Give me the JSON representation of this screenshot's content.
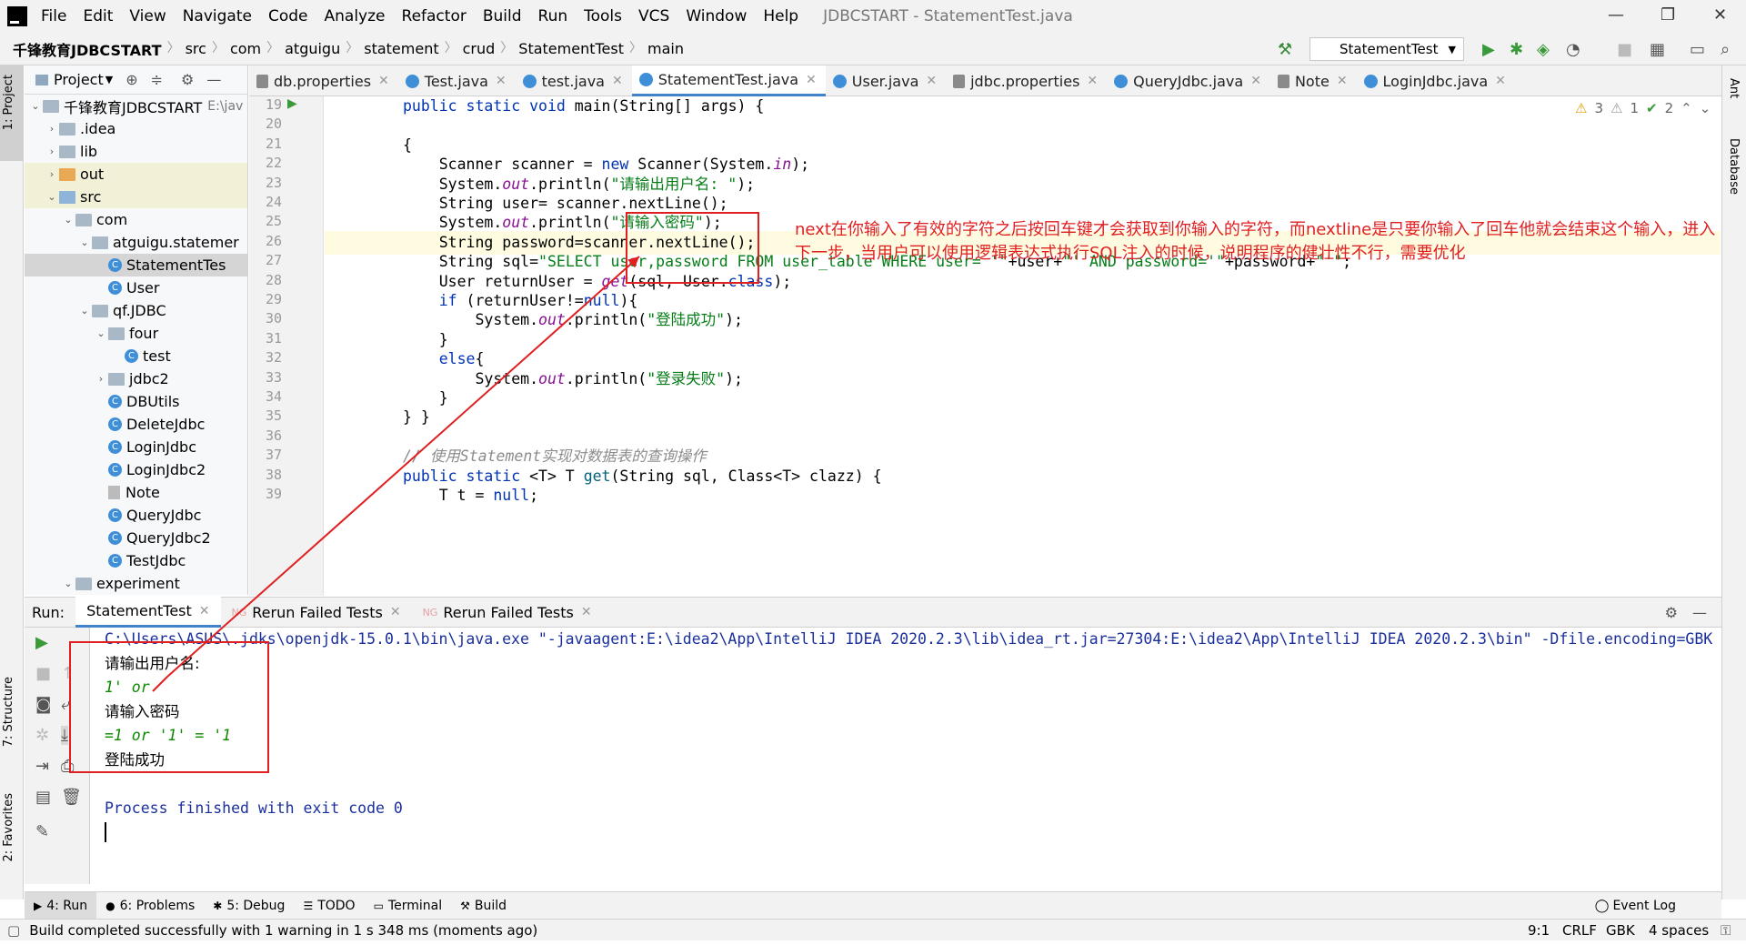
{
  "menu": [
    "File",
    "Edit",
    "View",
    "Navigate",
    "Code",
    "Analyze",
    "Refactor",
    "Build",
    "Run",
    "Tools",
    "VCS",
    "Window",
    "Help"
  ],
  "window_title": "JDBCSTART - StatementTest.java",
  "breadcrumbs": [
    "千锋教育JDBCSTART",
    "src",
    "com",
    "atguigu",
    "statement",
    "crud",
    "StatementTest",
    "main"
  ],
  "run_config": "StatementTest",
  "left_stripe": {
    "project": "1: Project",
    "structure": "7: Structure",
    "favorites": "2: Favorites"
  },
  "right_stripe": {
    "ant": "Ant",
    "database": "Database"
  },
  "project_panel": {
    "title": "Project",
    "tree": [
      {
        "label": "千锋教育JDBCSTART",
        "suffix": "E:\\jav",
        "indent": 0,
        "arrow": "down",
        "icon": "folder"
      },
      {
        "label": ".idea",
        "indent": 1,
        "arrow": "right",
        "icon": "folder"
      },
      {
        "label": "lib",
        "indent": 1,
        "arrow": "right",
        "icon": "folder"
      },
      {
        "label": "out",
        "indent": 1,
        "arrow": "right",
        "icon": "folder-orange"
      },
      {
        "label": "src",
        "indent": 1,
        "arrow": "down",
        "icon": "folder-blue"
      },
      {
        "label": "com",
        "indent": 2,
        "arrow": "down",
        "icon": "folder"
      },
      {
        "label": "atguigu.statemer",
        "indent": 3,
        "arrow": "down",
        "icon": "folder"
      },
      {
        "label": "StatementTes",
        "indent": 4,
        "arrow": "",
        "icon": "class"
      },
      {
        "label": "User",
        "indent": 4,
        "arrow": "",
        "icon": "class"
      },
      {
        "label": "qf.JDBC",
        "indent": 3,
        "arrow": "down",
        "icon": "folder"
      },
      {
        "label": "four",
        "indent": 4,
        "arrow": "down",
        "icon": "folder"
      },
      {
        "label": "test",
        "indent": 5,
        "arrow": "",
        "icon": "class"
      },
      {
        "label": "jdbc2",
        "indent": 4,
        "arrow": "right",
        "icon": "folder"
      },
      {
        "label": "DBUtils",
        "indent": 4,
        "arrow": "",
        "icon": "class"
      },
      {
        "label": "DeleteJdbc",
        "indent": 4,
        "arrow": "",
        "icon": "class"
      },
      {
        "label": "LoginJdbc",
        "indent": 4,
        "arrow": "",
        "icon": "class"
      },
      {
        "label": "LoginJdbc2",
        "indent": 4,
        "arrow": "",
        "icon": "class"
      },
      {
        "label": "Note",
        "indent": 4,
        "arrow": "",
        "icon": "note"
      },
      {
        "label": "QueryJdbc",
        "indent": 4,
        "arrow": "",
        "icon": "class"
      },
      {
        "label": "QueryJdbc2",
        "indent": 4,
        "arrow": "",
        "icon": "class"
      },
      {
        "label": "TestJdbc",
        "indent": 4,
        "arrow": "",
        "icon": "class"
      },
      {
        "label": "experiment",
        "indent": 2,
        "arrow": "down",
        "icon": "folder"
      }
    ]
  },
  "editor_tabs": [
    {
      "label": "db.properties",
      "icon": "prop"
    },
    {
      "label": "Test.java",
      "icon": "class"
    },
    {
      "label": "test.java",
      "icon": "class"
    },
    {
      "label": "StatementTest.java",
      "icon": "class",
      "active": true
    },
    {
      "label": "User.java",
      "icon": "class"
    },
    {
      "label": "jdbc.properties",
      "icon": "prop"
    },
    {
      "label": "QueryJdbc.java",
      "icon": "class"
    },
    {
      "label": "Note",
      "icon": "prop"
    },
    {
      "label": "LoginJdbc.java",
      "icon": "class"
    }
  ],
  "inspections": {
    "warnings": "3",
    "weak": "1",
    "ok": "2"
  },
  "code_lines": [
    {
      "n": "19",
      "html": "<span class='kw'>public static void</span> main(String[] args) {"
    },
    {
      "n": "20",
      "html": ""
    },
    {
      "n": "21",
      "html": "{"
    },
    {
      "n": "22",
      "html": "    Scanner scanner = <span class='kw'>new</span> Scanner(System.<span class='it'>in</span>);"
    },
    {
      "n": "23",
      "html": "    System.<span class='it'>out</span>.println(<span class='st'>\"请输出用户名: \"</span>);"
    },
    {
      "n": "24",
      "html": "    String user= scanner.nextLine();"
    },
    {
      "n": "25",
      "html": "    System.<span class='it'>out</span>.println(<span class='st'>\"请输入密码\"</span>);"
    },
    {
      "n": "26",
      "html": "    String password=scanner.nextLine();",
      "cur": true
    },
    {
      "n": "27",
      "html": "    String sql=<span class='st'>\"SELECT user,password FROM user_table WHERE user= '\"</span>+user+<span class='st'>\"' AND password='\"</span>+password+<span class='st'>\"'\"</span>;"
    },
    {
      "n": "28",
      "html": "    User returnUser = <span class='it'>get</span>(sql, User.<span class='kw'>class</span>);"
    },
    {
      "n": "29",
      "html": "    <span class='kw'>if</span> (returnUser!=<span class='kw'>null</span>){"
    },
    {
      "n": "30",
      "html": "        System.<span class='it'>out</span>.println(<span class='st'>\"登陆成功\"</span>);"
    },
    {
      "n": "31",
      "html": "    }"
    },
    {
      "n": "32",
      "html": "    <span class='kw'>else</span>{"
    },
    {
      "n": "33",
      "html": "        System.<span class='it'>out</span>.println(<span class='st'>\"登录失败\"</span>);"
    },
    {
      "n": "34",
      "html": "    }"
    },
    {
      "n": "35",
      "html": "} }"
    },
    {
      "n": "36",
      "html": ""
    },
    {
      "n": "37",
      "html": "<span class='cm'>// 使用Statement实现对数据表的查询操作</span>"
    },
    {
      "n": "38",
      "html": "<span class='kw'>public static</span> &lt;T&gt; T <span style='color:#00627a'>get</span>(String sql, Class&lt;T&gt; clazz) {"
    },
    {
      "n": "39",
      "html": "    T t = <span class='kw'>null</span>;"
    }
  ],
  "annotation": "next在你输入了有效的字符之后按回车键才会获取到你输入的字符，而nextline是只要你输入了回车他就会结束这个输入，进入下一步，当用户可以使用逻辑表达式执行SQL注入的时候，说明程序的健壮性不行，需要优化",
  "run_panel": {
    "label": "Run:",
    "tabs": [
      "StatementTest",
      "Rerun Failed Tests",
      "Rerun Failed Tests"
    ]
  },
  "console_lines": [
    {
      "text": "C:\\Users\\ASUS\\.jdks\\openjdk-15.0.1\\bin\\java.exe \"-javaagent:E:\\idea2\\App\\IntelliJ IDEA 2020.2.3\\lib\\idea_rt.jar=27304:E:\\idea2\\App\\IntelliJ IDEA 2020.2.3\\bin\" -Dfile.encoding=GBK",
      "cls": "mono blue"
    },
    {
      "text": "请输出用户名:",
      "cls": ""
    },
    {
      "text": "1' or",
      "cls": "mono green"
    },
    {
      "text": "请输入密码",
      "cls": ""
    },
    {
      "text": "=1 or '1' = '1",
      "cls": "mono green"
    },
    {
      "text": "登陆成功",
      "cls": ""
    },
    {
      "text": "",
      "cls": ""
    },
    {
      "text": "Process finished with exit code 0",
      "cls": "mono blue"
    }
  ],
  "bottom_tabs": [
    {
      "label": "4: Run",
      "icon": "▶",
      "active": true
    },
    {
      "label": "6: Problems",
      "icon": "●"
    },
    {
      "label": "5: Debug",
      "icon": "✱"
    },
    {
      "label": "TODO",
      "icon": "☰"
    },
    {
      "label": "Terminal",
      "icon": "▭"
    },
    {
      "label": "Build",
      "icon": "⚒"
    }
  ],
  "event_log": "Event Log",
  "status": {
    "message": "Build completed successfully with 1 warning in 1 s 348 ms (moments ago)",
    "position": "9:1",
    "line_sep": "CRLF",
    "encoding": "GBK",
    "indent": "4 spaces"
  }
}
